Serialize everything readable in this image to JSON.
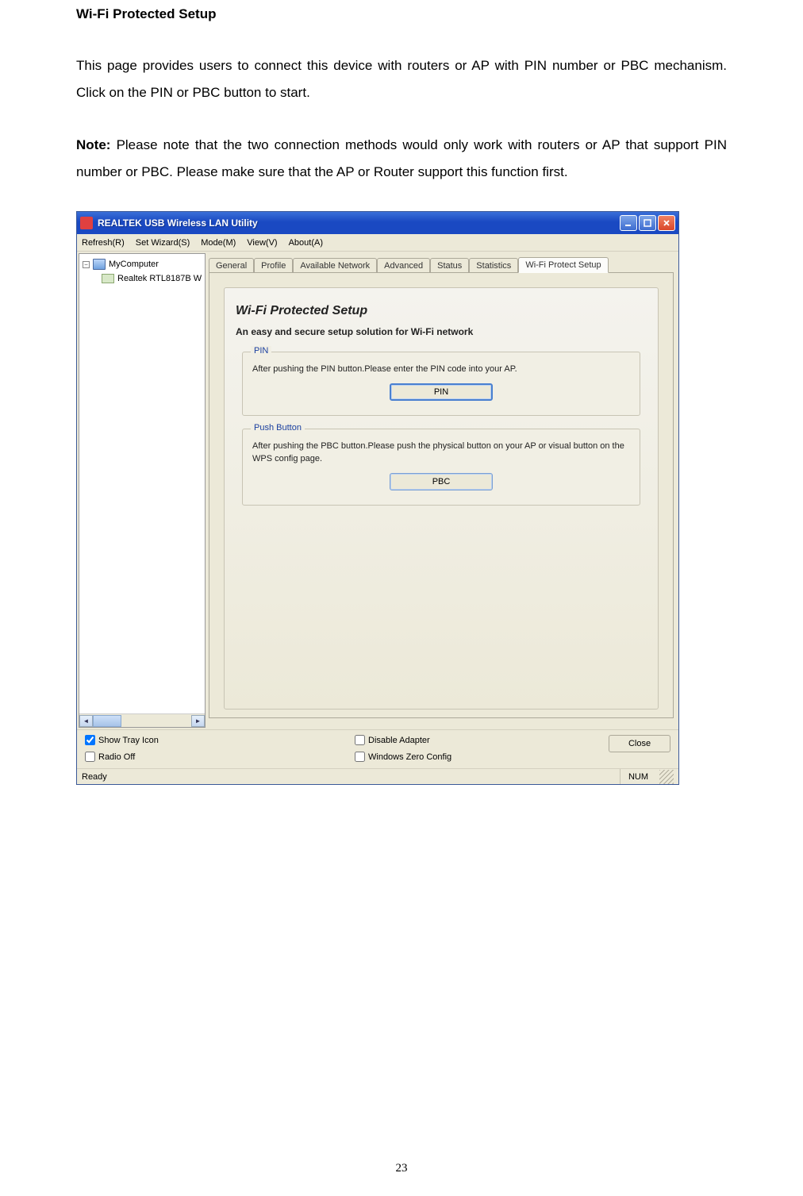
{
  "doc": {
    "heading": "Wi-Fi Protected Setup",
    "para1": "This page provides users to connect this device with routers or AP with PIN number or PBC mechanism. Click on the PIN or PBC button to start.",
    "note_label": "Note:",
    "note_text": " Please note that the two connection methods would only work with routers or AP that support PIN number or PBC. Please make sure that the AP or Router support this function first.",
    "page_number": "23"
  },
  "window": {
    "title": "REALTEK USB Wireless LAN Utility",
    "menus": [
      "Refresh(R)",
      "Set Wizard(S)",
      "Mode(M)",
      "View(V)",
      "About(A)"
    ],
    "tree": {
      "root": "MyComputer",
      "child": "Realtek RTL8187B W"
    },
    "tabs": [
      "General",
      "Profile",
      "Available Network",
      "Advanced",
      "Status",
      "Statistics",
      "Wi-Fi Protect Setup"
    ],
    "active_tab_index": 6,
    "panel": {
      "title": "Wi-Fi Protected Setup",
      "subtitle": "An easy and secure setup solution for Wi-Fi network",
      "pin_group": {
        "title": "PIN",
        "text": "After pushing the PIN button.Please enter the PIN code into your AP.",
        "button": "PIN"
      },
      "pbc_group": {
        "title": "Push Button",
        "text": "After pushing the PBC button.Please push the physical button on your AP or visual button on the WPS config page.",
        "button": "PBC"
      }
    },
    "bottom": {
      "show_tray": "Show Tray Icon",
      "radio_off": "Radio Off",
      "disable_adapter": "Disable Adapter",
      "win_zero": "Windows Zero Config",
      "close": "Close"
    },
    "status": {
      "ready": "Ready",
      "num": "NUM"
    },
    "checkbox_state": {
      "show_tray": true,
      "radio_off": false,
      "disable_adapter": false,
      "win_zero": false
    }
  }
}
